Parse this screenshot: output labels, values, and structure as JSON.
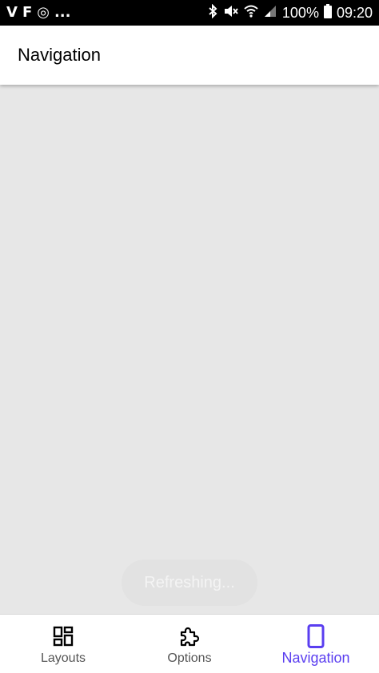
{
  "status_bar": {
    "left_glyphs": [
      "V",
      "F",
      "◎",
      "..."
    ],
    "battery_percent": "100%",
    "time": "09:20",
    "icons": [
      "bluetooth-icon",
      "mute-icon",
      "wifi-icon",
      "signal-icon",
      "battery-icon"
    ]
  },
  "app_bar": {
    "title": "Navigation"
  },
  "toast": {
    "text": "Refreshing..."
  },
  "bottom_nav": {
    "items": [
      {
        "label": "Layouts",
        "icon": "dashboard-icon",
        "active": false
      },
      {
        "label": "Options",
        "icon": "puzzle-icon",
        "active": false
      },
      {
        "label": "Navigation",
        "icon": "phone-icon",
        "active": true
      }
    ],
    "active_color": "#5a3ef0"
  }
}
